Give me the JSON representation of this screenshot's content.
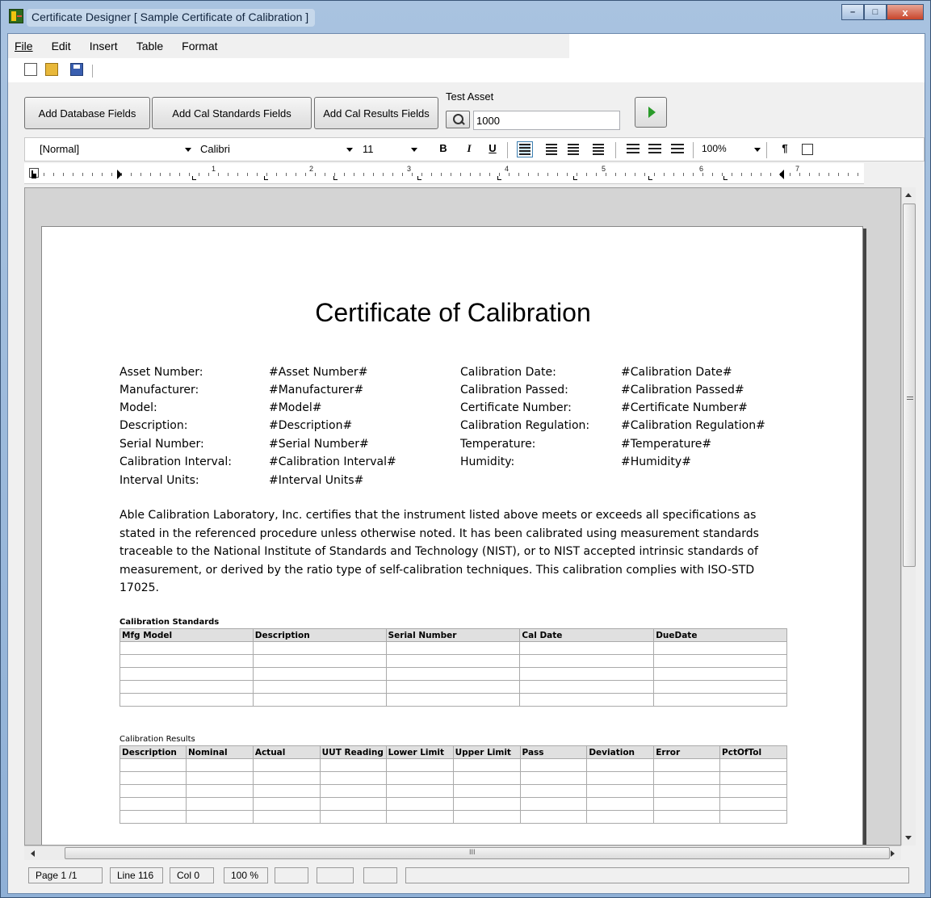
{
  "window": {
    "title": "Certificate Designer [ Sample Certificate of Calibration ]",
    "minimize": "–",
    "maximize": "□",
    "close": "x"
  },
  "menu": [
    "File",
    "Edit",
    "Insert",
    "Table",
    "Format"
  ],
  "toolbar": {
    "add_database_fields": "Add Database Fields",
    "add_cal_standards_fields": "Add Cal Standards Fields",
    "add_cal_results_fields": "Add Cal Results Fields",
    "test_asset_label": "Test Asset",
    "test_asset_value": "1000"
  },
  "format_bar": {
    "style": "[Normal]",
    "font": "Calibri",
    "size": "11",
    "bold": "B",
    "italic": "I",
    "underline": "U",
    "zoom": "100%",
    "pilcrow": "¶"
  },
  "ruler": {
    "numbers": [
      "1",
      "2",
      "3",
      "4",
      "5",
      "6",
      "7"
    ]
  },
  "document": {
    "title": "Certificate of Calibration",
    "left_fields": [
      {
        "label": "Asset Number:",
        "value": "#Asset Number#"
      },
      {
        "label": "Manufacturer:",
        "value": "#Manufacturer#"
      },
      {
        "label": "Model:",
        "value": "#Model#"
      },
      {
        "label": "Description:",
        "value": "#Description#"
      },
      {
        "label": "Serial Number:",
        "value": "#Serial Number#"
      },
      {
        "label": "Calibration Interval:",
        "value": "#Calibration Interval#"
      },
      {
        "label": "Interval Units:",
        "value": "#Interval Units#"
      }
    ],
    "right_fields": [
      {
        "label": "Calibration Date:",
        "value": "#Calibration Date#"
      },
      {
        "label": "Calibration Passed:",
        "value": "#Calibration Passed#"
      },
      {
        "label": "Certificate Number:",
        "value": "#Certificate Number#"
      },
      {
        "label": "Calibration Regulation:",
        "value": "#Calibration Regulation#"
      },
      {
        "label": "Temperature:",
        "value": "#Temperature#"
      },
      {
        "label": "Humidity:",
        "value": "#Humidity#"
      }
    ],
    "paragraph": "Able Calibration Laboratory, Inc. certifies that the instrument listed above meets or exceeds all specifications as stated in the referenced procedure  unless otherwise  noted. It has been calibrated using measurement standards traceable to the National Institute of Standards and Technology (NIST), or to NIST accepted intrinsic standards of measurement, or derived by the ratio type of self-calibration techniques. This calibration complies with ISO-STD 17025.",
    "standards_caption": "Calibration Standards",
    "standards_headers": [
      "Mfg Model",
      "Description",
      "Serial Number",
      "Cal Date",
      "DueDate"
    ],
    "results_caption": "Calibration Results",
    "results_headers": [
      "Description",
      "Nominal",
      "Actual",
      "UUT Reading",
      "Lower Limit",
      "Upper Limit",
      "Pass",
      "Deviation",
      "Error",
      "PctOfTol"
    ]
  },
  "status": {
    "page": "Page 1 /1",
    "line": "Line 116",
    "col": "Col 0",
    "zoom": "100 %"
  },
  "hscroll_grip": "III"
}
